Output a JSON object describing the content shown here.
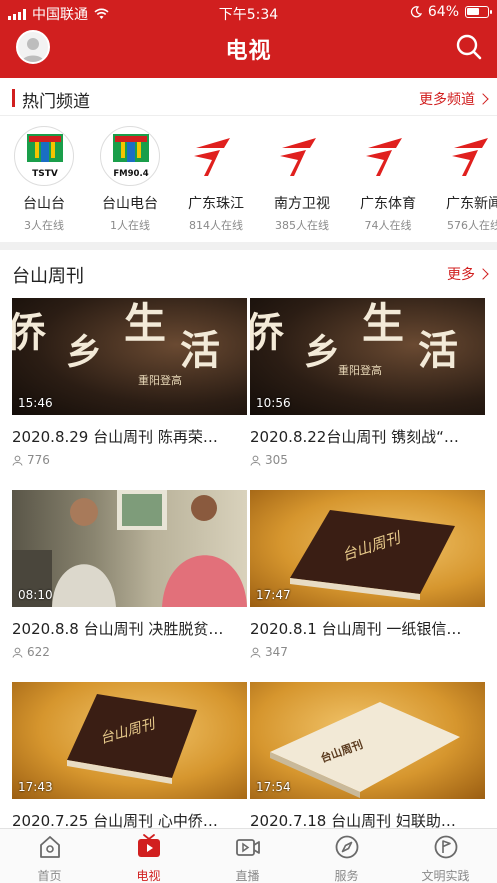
{
  "status_bar": {
    "carrier": "中国联通",
    "time": "下午5:34",
    "battery": "64%",
    "battery_level": 0.64
  },
  "header": {
    "title": "电视"
  },
  "hot_channels": {
    "title": "热门频道",
    "more_label": "更多频道",
    "items": [
      {
        "name": "台山台",
        "count": "3人在线",
        "logo": "tstv-logo",
        "logo_text": "TSTV"
      },
      {
        "name": "台山电台",
        "count": "1人在线",
        "logo": "fm90-logo",
        "logo_text": "FM90.4"
      },
      {
        "name": "广东珠江",
        "count": "814人在线",
        "logo": "gdtv-logo"
      },
      {
        "name": "南方卫视",
        "count": "385人在线",
        "logo": "gdtv-logo"
      },
      {
        "name": "广东体育",
        "count": "74人在线",
        "logo": "gdtv-logo"
      },
      {
        "name": "广东新闻",
        "count": "576人在线",
        "logo": "gdtv-logo"
      }
    ]
  },
  "weekly": {
    "title": "台山周刊",
    "more_label": "更多",
    "videos": [
      {
        "title": "2020.8.29 台山周刊 陈再荣…",
        "views": "776",
        "duration": "15:46",
        "thumb": "qiaoxiang-shenghuo",
        "thumb_text": [
          "侨",
          "乡",
          "生",
          "活"
        ],
        "thumb_sub": "重阳登高"
      },
      {
        "title": "2020.8.22台山周刊 镌刻战“…",
        "views": "305",
        "duration": "10:56",
        "thumb": "qiaoxiang-shenghuo",
        "thumb_text": [
          "侨",
          "乡",
          "生",
          "活"
        ],
        "thumb_sub": "重阳登高"
      },
      {
        "title": "2020.8.8 台山周刊 决胜脱贫…",
        "views": "622",
        "duration": "08:10",
        "thumb": "two-men-photo"
      },
      {
        "title": "2020.8.1 台山周刊 一纸银信…",
        "views": "347",
        "duration": "17:47",
        "thumb": "book-cover",
        "thumb_text": "台山周刊"
      },
      {
        "title": "2020.7.25 台山周刊 心中侨…",
        "views": "",
        "duration": "17:43",
        "thumb": "book-cover",
        "thumb_text": "台山周刊"
      },
      {
        "title": "2020.7.18 台山周刊 妇联助…",
        "views": "",
        "duration": "17:54",
        "thumb": "book-open",
        "thumb_text": "台山周刊"
      }
    ]
  },
  "tabbar": {
    "items": [
      {
        "label": "首页",
        "icon": "home-icon",
        "active": false
      },
      {
        "label": "电视",
        "icon": "tv-icon",
        "active": true
      },
      {
        "label": "直播",
        "icon": "live-video-icon",
        "active": false
      },
      {
        "label": "服务",
        "icon": "compass-icon",
        "active": false
      },
      {
        "label": "文明实践",
        "icon": "flag-icon",
        "active": false
      }
    ]
  },
  "colors": {
    "brand": "#d11f1f",
    "muted": "#8a8a8a"
  }
}
